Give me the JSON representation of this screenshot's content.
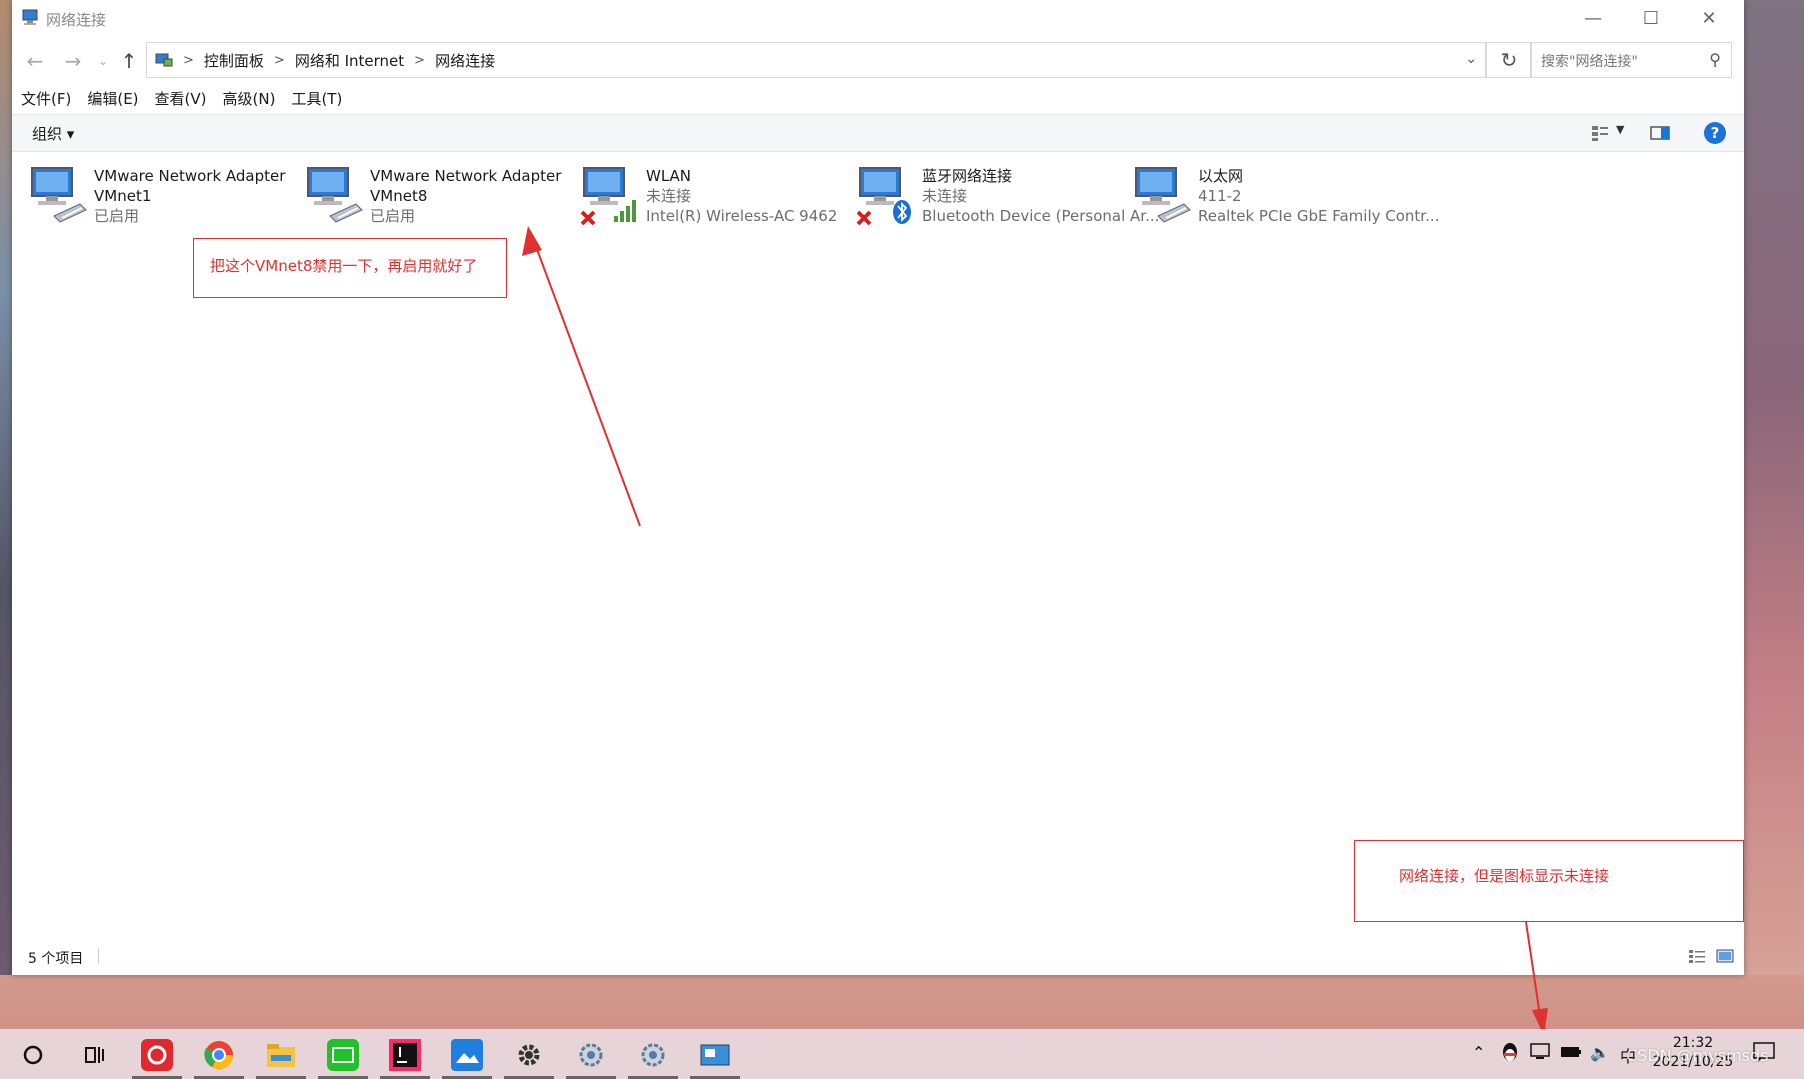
{
  "window": {
    "title": "网络连接"
  },
  "address": {
    "crumbs": [
      "控制面板",
      "网络和 Internet",
      "网络连接"
    ],
    "search_placeholder": "搜索\"网络连接\""
  },
  "menu": [
    "文件(F)",
    "编辑(E)",
    "查看(V)",
    "高级(N)",
    "工具(T)"
  ],
  "toolbar": {
    "organize": "组织 ▾",
    "help": "?"
  },
  "items": [
    {
      "l1": "VMware Network Adapter",
      "l2": "VMnet1",
      "l3": "已启用",
      "status": "enabled"
    },
    {
      "l1": "VMware Network Adapter",
      "l2": "VMnet8",
      "l3": "已启用",
      "status": "enabled"
    },
    {
      "l1": "WLAN",
      "l2": "未连接",
      "l3": "Intel(R) Wireless-AC 9462",
      "status": "wifi-disconnected"
    },
    {
      "l1": "蓝牙网络连接",
      "l2": "未连接",
      "l3": "Bluetooth Device (Personal Ar...",
      "status": "bt-disconnected"
    },
    {
      "l1": "以太网",
      "l2": "411-2",
      "l3": "Realtek PCIe GbE Family Contr...",
      "status": "connected"
    }
  ],
  "annotations": {
    "a1": "把这个VMnet8禁用一下，再启用就好了",
    "a2": "网络连接，但是图标显示未连接"
  },
  "status": {
    "count": "5 个项目"
  },
  "taskbar": {
    "time": "21:32",
    "date": "2021/10/25",
    "ime": "中",
    "watermark": "CSDN @mysmsds"
  },
  "colors": {
    "annotation": "#e03030",
    "accent": "#1a73d9"
  }
}
